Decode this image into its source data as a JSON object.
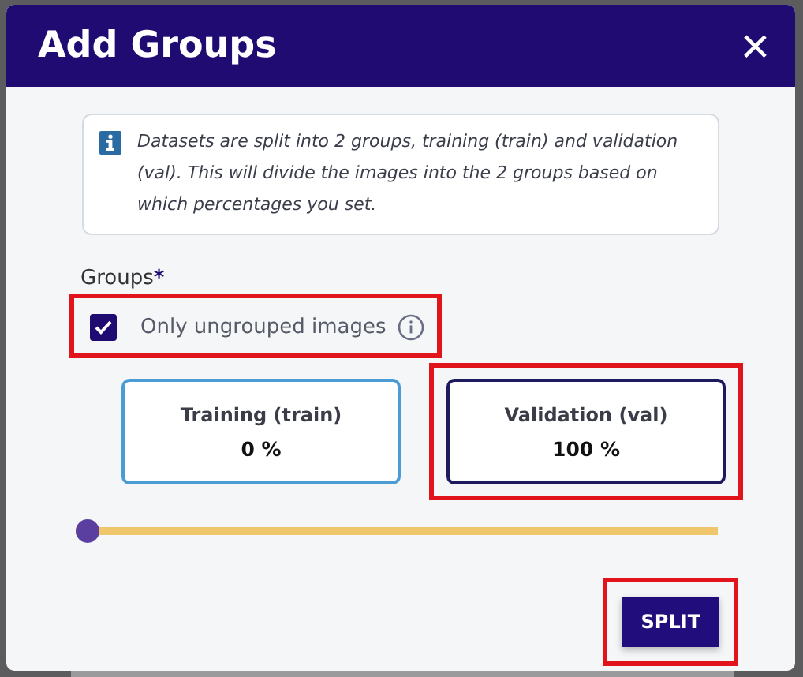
{
  "dialog": {
    "title": "Add Groups",
    "close": "×"
  },
  "info": {
    "text": "Datasets are split into 2 groups, training (train) and validation (val). This will divide the images into the 2 groups based on which percentages you set."
  },
  "groups": {
    "label": "Groups",
    "required_mark": "*",
    "checkbox": {
      "label": "Only ungrouped images",
      "checked": true,
      "highlighted": true
    },
    "cards": [
      {
        "label": "Training (train)",
        "value": "0 %",
        "selected": false,
        "highlighted": false
      },
      {
        "label": "Validation (val)",
        "value": "100 %",
        "selected": true,
        "highlighted": true
      }
    ],
    "slider": {
      "level": 0
    }
  },
  "split_button": {
    "label": "SPLIT",
    "highlighted": true
  }
}
